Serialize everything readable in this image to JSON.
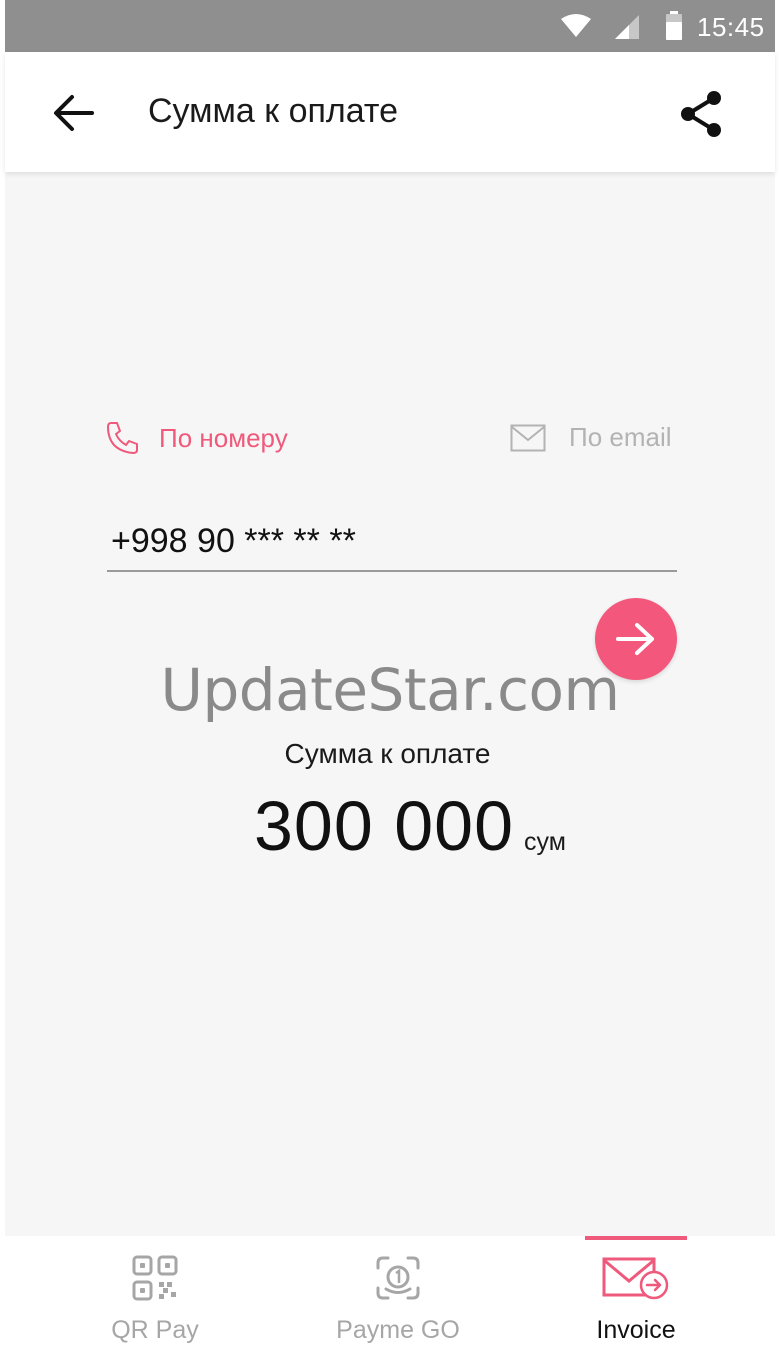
{
  "status_bar": {
    "time": "15:45"
  },
  "app_bar": {
    "title": "Сумма к оплате"
  },
  "tabs": [
    {
      "label": "По номеру",
      "active": true
    },
    {
      "label": "По email",
      "active": false
    }
  ],
  "phone_input": {
    "value": "+998 90 *** ** **"
  },
  "watermark": "UpdateStar.com",
  "amount": {
    "label": "Сумма к оплате",
    "value": "300 000",
    "currency": "сум"
  },
  "bottom_nav": [
    {
      "label": "QR Pay",
      "icon": "qr-code-icon",
      "active": false
    },
    {
      "label": "Payme GO",
      "icon": "payme-go-icon",
      "active": false
    },
    {
      "label": "Invoice",
      "icon": "invoice-icon",
      "active": true
    }
  ],
  "colors": {
    "accent": "#f3587c",
    "status_bar": "#8f8f8f",
    "background": "#f6f6f6",
    "inactive": "#b3b3b3"
  }
}
